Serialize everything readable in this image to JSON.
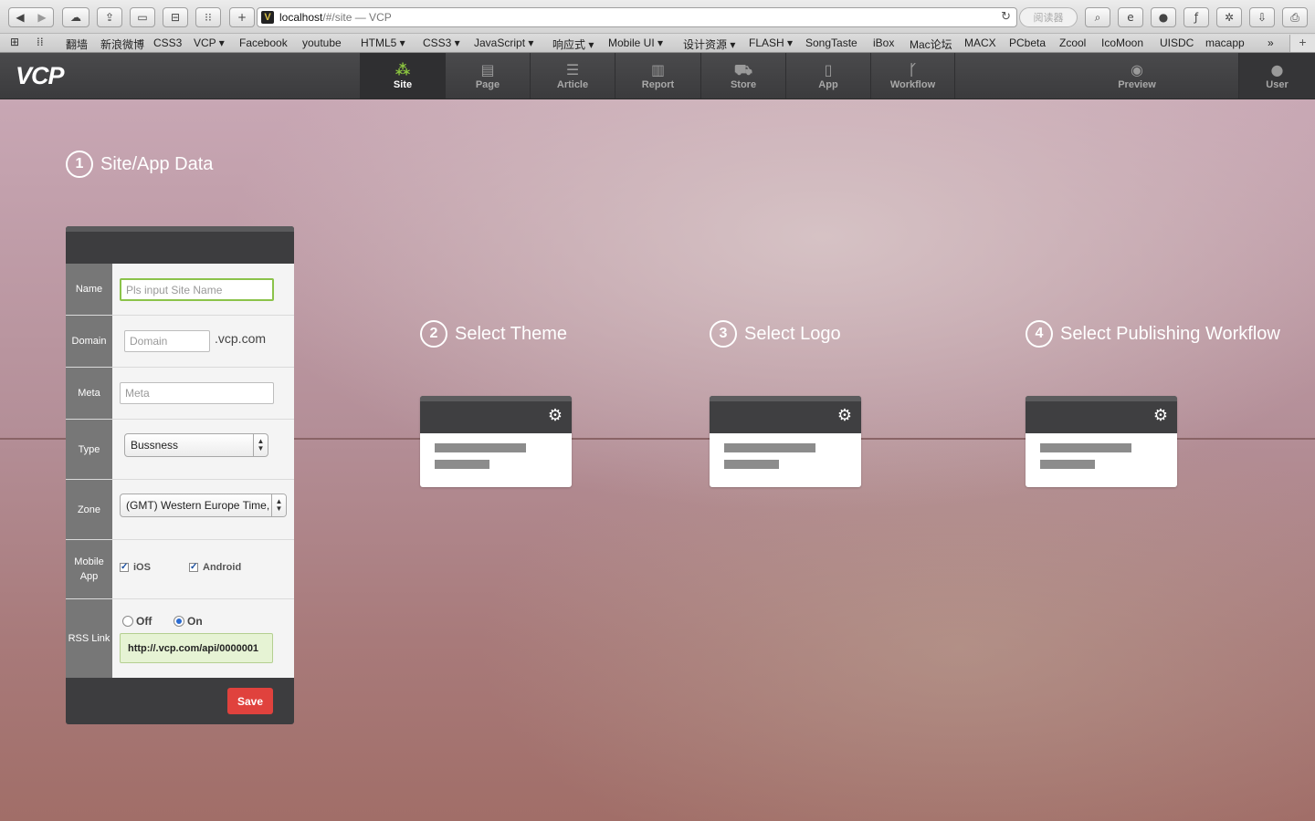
{
  "browser": {
    "url_host": "localhost",
    "url_path": "/#/site — VCP",
    "reader_label": "阅读器",
    "bookmarks": [
      "翻墙",
      "新浪微博",
      "CSS3",
      "VCP ▾",
      "Facebook",
      "youtube",
      "HTML5 ▾",
      "CSS3 ▾",
      "JavaScript ▾",
      "响应式 ▾",
      "Mobile UI ▾",
      "设计资源 ▾",
      "FLASH ▾",
      "SongTaste",
      "iBox",
      "Mac论坛",
      "MACX",
      "PCbeta",
      "Zcool",
      "IcoMoon",
      "UISDC",
      "macapp"
    ],
    "icons": [
      "back-icon",
      "forward-icon",
      "icloud-icon",
      "share-icon",
      "reading-list-icon",
      "bookmarks-icon",
      "top-sites-icon",
      "new-tab-icon",
      "reload-icon",
      "search-icon",
      "ie-icon",
      "record-icon",
      "script-icon",
      "tools-icon",
      "download-icon",
      "print-icon"
    ]
  },
  "app": {
    "logo": "VCP",
    "nav": [
      {
        "label": "Site",
        "icon": "sitemap-icon",
        "active": true
      },
      {
        "label": "Page",
        "icon": "document-icon"
      },
      {
        "label": "Article",
        "icon": "list-icon"
      },
      {
        "label": "Report",
        "icon": "bar-chart-icon"
      },
      {
        "label": "Store",
        "icon": "cart-icon"
      },
      {
        "label": "App",
        "icon": "phone-icon"
      },
      {
        "label": "Workflow",
        "icon": "branch-icon"
      },
      {
        "label": "Preview",
        "icon": "eye-icon"
      },
      {
        "label": "User",
        "icon": "user-icon"
      }
    ]
  },
  "steps": [
    {
      "num": "1",
      "title": "Site/App Data"
    },
    {
      "num": "2",
      "title": "Select Theme"
    },
    {
      "num": "3",
      "title": "Select Logo"
    },
    {
      "num": "4",
      "title": "Select Publishing Workflow"
    }
  ],
  "form": {
    "name_label": "Name",
    "name_placeholder": "Pls input Site Name",
    "domain_label": "Domain",
    "domain_placeholder": "Domain",
    "domain_suffix": ".vcp.com",
    "meta_label": "Meta",
    "meta_placeholder": "Meta",
    "type_label": "Type",
    "type_value": "Bussness",
    "zone_label": "Zone",
    "zone_value": "(GMT) Western Europe Time,",
    "mobile_label_1": "Mobile",
    "mobile_label_2": "App",
    "ios_label": "iOS",
    "ios_checked": true,
    "android_label": "Android",
    "android_checked": true,
    "rss_label": "RSS Link",
    "rss_off": "Off",
    "rss_on": "On",
    "rss_selected": "On",
    "rss_url": "http://.vcp.com/api/0000001",
    "save_label": "Save"
  }
}
